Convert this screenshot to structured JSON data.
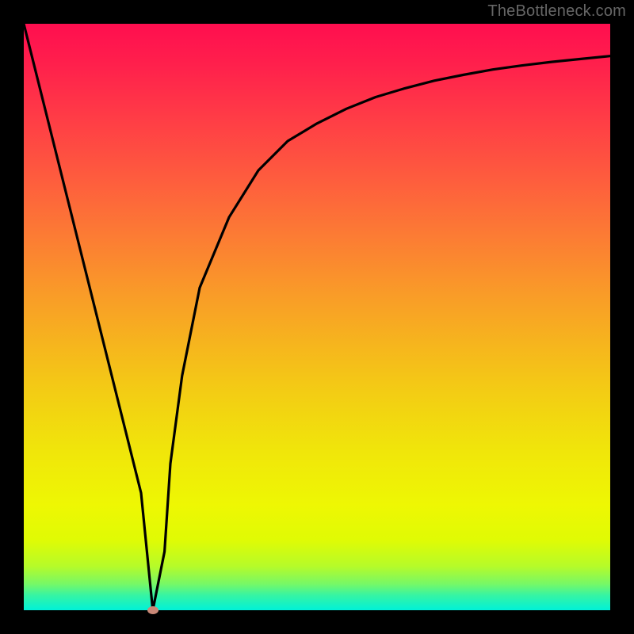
{
  "attribution": "TheBottleneck.com",
  "chart_data": {
    "type": "line",
    "title": "",
    "xlabel": "",
    "ylabel": "",
    "xlim": [
      0,
      100
    ],
    "ylim": [
      0,
      100
    ],
    "x": [
      0,
      5,
      10,
      15,
      20,
      22,
      24,
      25,
      27,
      30,
      35,
      40,
      45,
      50,
      55,
      60,
      65,
      70,
      75,
      80,
      85,
      90,
      95,
      100
    ],
    "values": [
      100,
      80,
      60,
      40,
      20,
      0,
      10,
      25,
      40,
      55,
      67,
      75,
      80,
      83,
      85.5,
      87.5,
      89,
      90.3,
      91.3,
      92.2,
      92.9,
      93.5,
      94.0,
      94.5
    ],
    "marker": {
      "x": 22,
      "y": 0,
      "color": "#c98877"
    },
    "gradient_stops": [
      {
        "offset": 0,
        "color": "#ff0e4f"
      },
      {
        "offset": 0.07,
        "color": "#ff204c"
      },
      {
        "offset": 0.16,
        "color": "#ff3c46"
      },
      {
        "offset": 0.26,
        "color": "#fe5b3e"
      },
      {
        "offset": 0.36,
        "color": "#fc7b34"
      },
      {
        "offset": 0.46,
        "color": "#f99b28"
      },
      {
        "offset": 0.55,
        "color": "#f6b61d"
      },
      {
        "offset": 0.63,
        "color": "#f3cd14"
      },
      {
        "offset": 0.73,
        "color": "#f0e60a"
      },
      {
        "offset": 0.82,
        "color": "#eef703"
      },
      {
        "offset": 0.88,
        "color": "#e0fb04"
      },
      {
        "offset": 0.925,
        "color": "#b6fb29"
      },
      {
        "offset": 0.955,
        "color": "#77f866"
      },
      {
        "offset": 0.975,
        "color": "#35f4a5"
      },
      {
        "offset": 1.0,
        "color": "#00f1d8"
      }
    ]
  }
}
